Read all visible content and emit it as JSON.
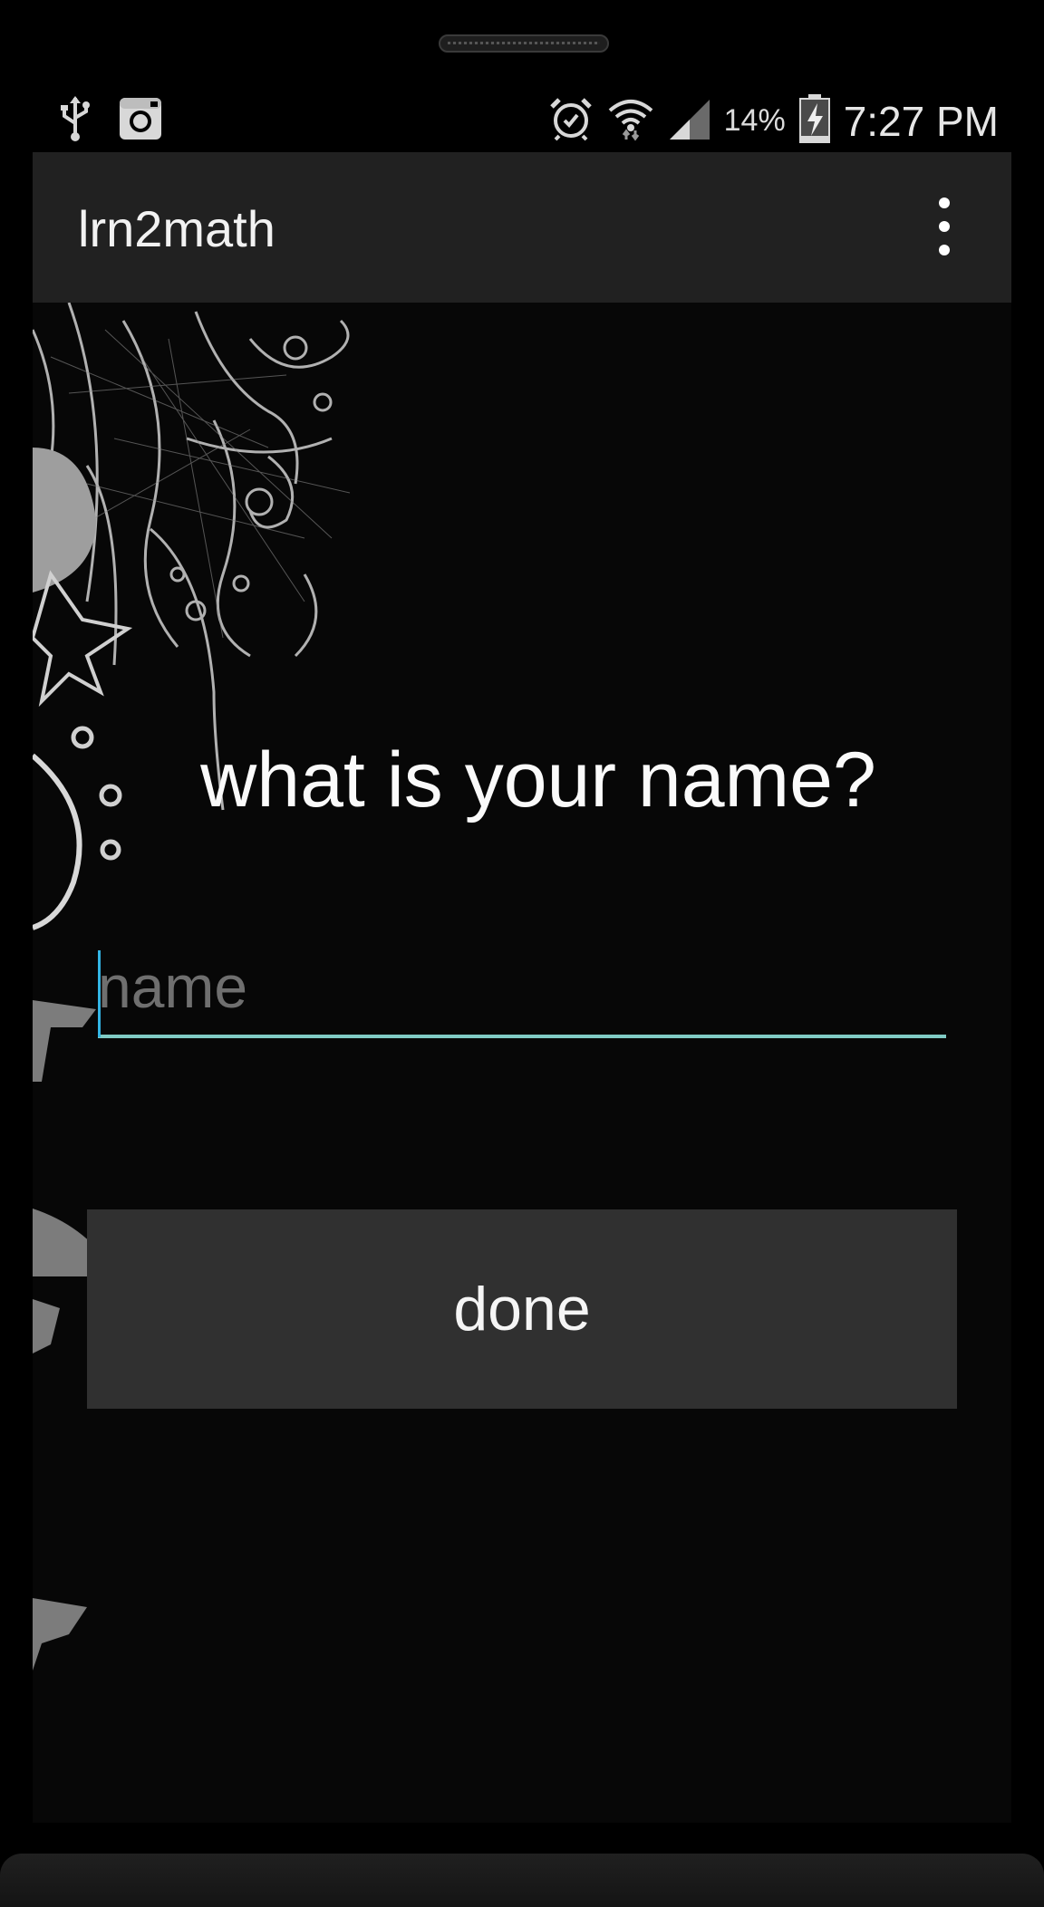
{
  "status_bar": {
    "battery_percent": "14%",
    "time": "7:27 PM",
    "icons": [
      "usb-icon",
      "instagram-icon",
      "alarm-icon",
      "wifi-icon",
      "signal-icon",
      "battery-charging-icon"
    ]
  },
  "action_bar": {
    "title": "lrn2math",
    "menu_icon": "overflow-menu-icon"
  },
  "main": {
    "question": "what is your name?",
    "name_input": {
      "value": "",
      "placeholder": "name"
    },
    "done_label": "done"
  },
  "colors": {
    "action_bar_bg": "#212121",
    "screen_bg": "#070707",
    "input_underline": "#80cbc4",
    "cursor": "#33b5e5",
    "button_bg": "#303030"
  }
}
